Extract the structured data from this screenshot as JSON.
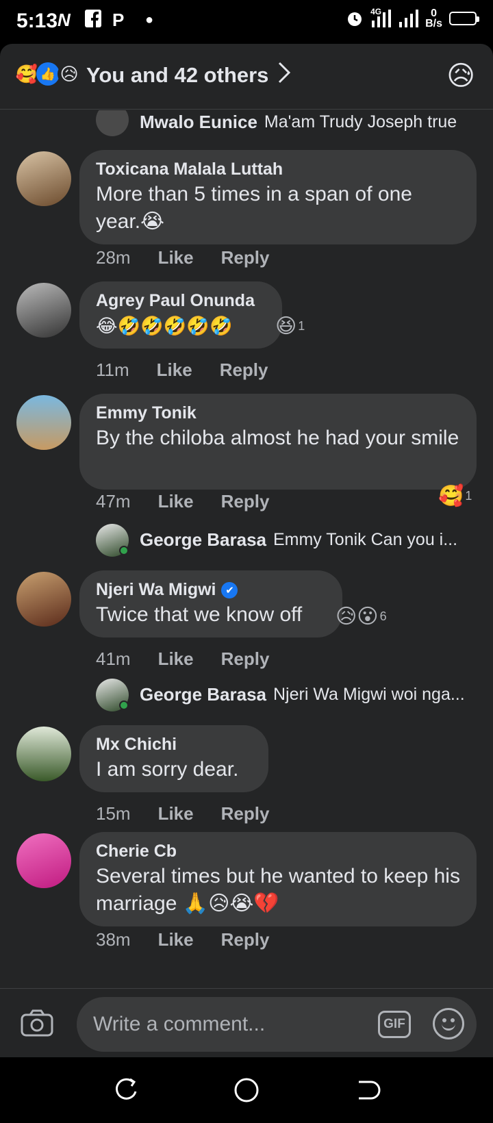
{
  "status_bar": {
    "time": "5:13",
    "icons": [
      "netflix-icon",
      "facebook-icon",
      "pinterest-icon",
      "dot-icon"
    ],
    "network": "4G",
    "speed_value": "0",
    "speed_unit": "B/s"
  },
  "reactions_header": {
    "emojis": [
      "🥰",
      "👍",
      "😥"
    ],
    "text": "You and 42 others",
    "my_reaction": "😥"
  },
  "comments": [
    {
      "name": "Mwalo Eunice",
      "text": "Ma'am Trudy Joseph true"
    },
    {
      "name": "Toxicana Malala Luttah",
      "text": "More than 5 times in a span of one year.😭",
      "time": "28m",
      "like": "Like",
      "reply": "Reply"
    },
    {
      "name": "Agrey Paul Onunda",
      "text": "😂🤣🤣🤣🤣🤣",
      "time": "11m",
      "like": "Like",
      "reply": "Reply",
      "reaction": "😆",
      "reaction_count": "1"
    },
    {
      "name": "Emmy Tonik",
      "text": "By the chiloba almost he had your smile",
      "time": "47m",
      "like": "Like",
      "reply": "Reply",
      "reaction": "🥰",
      "reaction_count": "1"
    },
    {
      "name": "George Barasa",
      "text": "Emmy Tonik Can you i..."
    },
    {
      "name": "Njeri Wa Migwi",
      "verified": "✔",
      "text": "Twice that we know off",
      "time": "41m",
      "like": "Like",
      "reply": "Reply",
      "reaction": "😥😮",
      "reaction_count": "6"
    },
    {
      "name": "George Barasa",
      "text": "Njeri Wa Migwi woi nga..."
    },
    {
      "name": "Mx Chichi",
      "text": "I am sorry dear.",
      "time": "15m",
      "like": "Like",
      "reply": "Reply"
    },
    {
      "name": "Cherie Cb",
      "text": "Several times but he wanted to keep his marriage 🙏😥😭💔",
      "time": "38m",
      "like": "Like",
      "reply": "Reply"
    }
  ],
  "composer": {
    "placeholder": "Write a comment...",
    "gif_label": "GIF"
  },
  "colors": {
    "panel_bg": "#242526",
    "bubble_bg": "#3a3b3c",
    "text_primary": "#e4e6eb",
    "text_secondary": "#b0b3b8",
    "accent": "#1877f2"
  }
}
